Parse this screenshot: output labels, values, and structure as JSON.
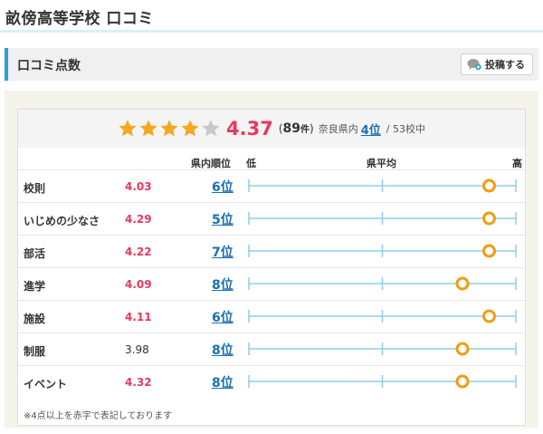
{
  "page": {
    "title": "畝傍高等学校 口コミ"
  },
  "section": {
    "title": "口コミ点数",
    "post_button": "投稿する"
  },
  "summary": {
    "score": "4.37",
    "rating_fraction": 0.874,
    "count_open": "(",
    "count": "89",
    "count_unit": "件",
    "count_close": ")",
    "pref_label": "奈良県内",
    "pref_rank": "4位",
    "slash_total": "/ 53校中"
  },
  "columns": {
    "rank": "県内順位",
    "low": "低",
    "avg": "県平均",
    "high": "高"
  },
  "rows": [
    {
      "label": "校則",
      "score": "4.03",
      "highlight": true,
      "rank": "6位",
      "level": 0.9
    },
    {
      "label": "いじめの少なさ",
      "score": "4.29",
      "highlight": true,
      "rank": "5位",
      "level": 0.9
    },
    {
      "label": "部活",
      "score": "4.22",
      "highlight": true,
      "rank": "7位",
      "level": 0.9
    },
    {
      "label": "進学",
      "score": "4.09",
      "highlight": true,
      "rank": "8位",
      "level": 0.8
    },
    {
      "label": "施設",
      "score": "4.11",
      "highlight": true,
      "rank": "6位",
      "level": 0.9
    },
    {
      "label": "制服",
      "score": "3.98",
      "highlight": false,
      "rank": "8位",
      "level": 0.8
    },
    {
      "label": "イベント",
      "score": "4.32",
      "highlight": true,
      "rank": "8位",
      "level": 0.8
    }
  ],
  "footnote": "※4点以上を赤字で表記しております",
  "colors": {
    "accent_blue": "#2a9fd8",
    "score_red": "#e8385e",
    "link_blue": "#1a6fb3",
    "star_gold": "#f4a81d",
    "star_gray": "#c8c8c8",
    "marker_orange": "#f39c12",
    "bar_line": "#8fcfe6"
  }
}
